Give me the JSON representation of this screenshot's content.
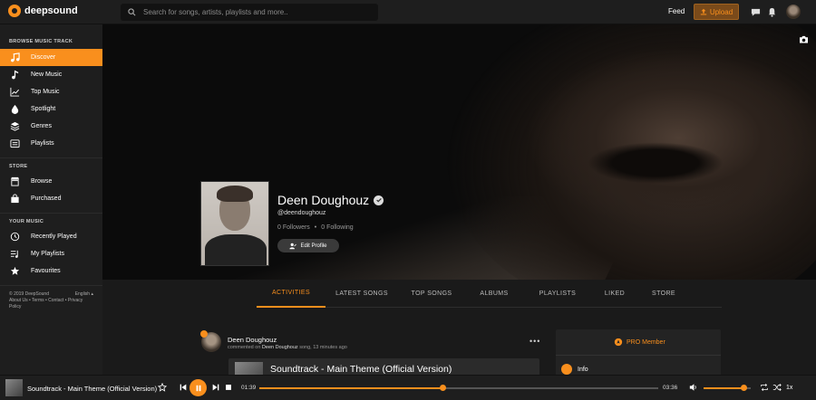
{
  "app": {
    "name": "deepsound"
  },
  "header": {
    "search_placeholder": "Search for songs, artists, playlists and more..",
    "feed_label": "Feed",
    "upload_label": "Upload"
  },
  "colors": {
    "accent": "#f98f1d",
    "sidebar_bg": "#1e1e1e",
    "page_bg": "#1a1a1a"
  },
  "sidebar": {
    "browse_heading": "BROWSE MUSIC TRACK",
    "browse_items": [
      {
        "label": "Discover",
        "icon": "music-notes-icon",
        "active": true
      },
      {
        "label": "New Music",
        "icon": "music-note-icon"
      },
      {
        "label": "Top Music",
        "icon": "trending-icon"
      },
      {
        "label": "Spotlight",
        "icon": "drop-icon"
      },
      {
        "label": "Genres",
        "icon": "layers-icon"
      },
      {
        "label": "Playlists",
        "icon": "playlist-icon"
      }
    ],
    "store_heading": "STORE",
    "store_items": [
      {
        "label": "Browse",
        "icon": "store-icon"
      },
      {
        "label": "Purchased",
        "icon": "bag-icon"
      }
    ],
    "music_heading": "YOUR MUSIC",
    "music_items": [
      {
        "label": "Recently Played",
        "icon": "history-icon"
      },
      {
        "label": "My Playlists",
        "icon": "my-playlist-icon"
      },
      {
        "label": "Favourites",
        "icon": "star-icon"
      }
    ],
    "footer": {
      "copyright": "© 2019 DeepSound",
      "language": "English",
      "links": "About Us • Terms • Contact • Privacy Policy"
    }
  },
  "profile": {
    "name": "Deen Doughouz",
    "handle": "@deendoughouz",
    "followers": "0 Followers",
    "following": "0 Following",
    "separator": "•",
    "edit_label": "Edit Profile"
  },
  "tabs": [
    {
      "label": "ACTIVITIES",
      "active": true
    },
    {
      "label": "LATEST SONGS"
    },
    {
      "label": "TOP SONGS"
    },
    {
      "label": "ALBUMS"
    },
    {
      "label": "PLAYLISTS"
    },
    {
      "label": "LIKED"
    },
    {
      "label": "STORE"
    }
  ],
  "activity": {
    "user": "Deen Doughouz",
    "meta_prefix": "commented on",
    "meta_user": "Deen Doughouz",
    "meta_suffix": "song, 13 minutes ago",
    "more": "•••",
    "song_title": "Soundtrack - Main Theme (Official Version)"
  },
  "side_card": {
    "pro_label": "PRO Member",
    "info_label": "Info"
  },
  "player": {
    "title": "Soundtrack - Main Theme (Official Version)",
    "current_time": "01:39",
    "duration": "03:36",
    "progress": 0.46,
    "volume": 0.85,
    "speed": "1x"
  }
}
